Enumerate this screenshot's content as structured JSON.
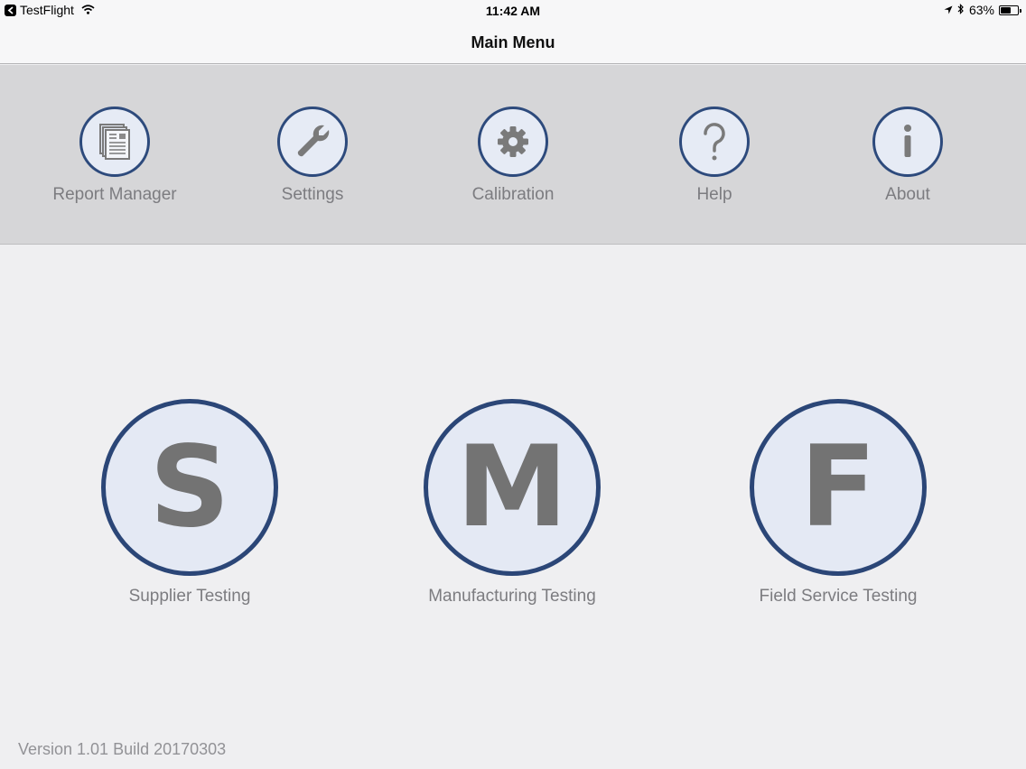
{
  "status_bar": {
    "app": "TestFlight",
    "time": "11:42 AM",
    "battery": "63%",
    "battery_level": 0.63
  },
  "nav": {
    "title": "Main Menu"
  },
  "tools": [
    {
      "label": "Report Manager",
      "icon": "documents-icon"
    },
    {
      "label": "Settings",
      "icon": "wrench-icon"
    },
    {
      "label": "Calibration",
      "icon": "gear-icon"
    },
    {
      "label": "Help",
      "icon": "question-icon"
    },
    {
      "label": "About",
      "icon": "info-icon"
    }
  ],
  "modes": [
    {
      "letter": "S",
      "label": "Supplier Testing"
    },
    {
      "letter": "M",
      "label": "Manufacturing Testing"
    },
    {
      "letter": "F",
      "label": "Field Service Testing"
    }
  ],
  "version": "Version 1.01 Build 20170303",
  "colors": {
    "accent": "#2b4677",
    "circle_fill": "#e4e9f4",
    "icon_gray": "#737373"
  }
}
